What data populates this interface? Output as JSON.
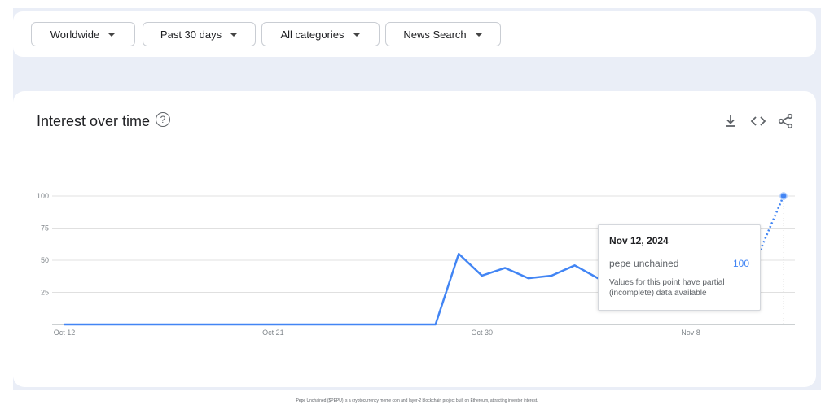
{
  "filters": [
    {
      "label": "Worldwide"
    },
    {
      "label": "Past 30 days"
    },
    {
      "label": "All categories"
    },
    {
      "label": "News Search"
    }
  ],
  "card": {
    "title": "Interest over time",
    "help_icon": "question-circle-icon",
    "actions": [
      "download-icon",
      "embed-code-icon",
      "share-icon"
    ]
  },
  "tooltip": {
    "date": "Nov 12, 2024",
    "term": "pepe unchained",
    "value": "100",
    "note": "Values for this point have partial (incomplete) data available"
  },
  "footnote": "Pepe Unchained ($PEPU) is a cryptocurrency meme coin and layer-2 blockchain project built on Ethereum, attracting investor interest.",
  "colors": {
    "line": "#4285f4",
    "grid": "#e0e0e0",
    "card_bg": "#ffffff",
    "page_bg": "#eaeef7"
  },
  "chart_data": {
    "type": "line",
    "title": "",
    "xlabel": "",
    "ylabel": "",
    "ylim": [
      0,
      100
    ],
    "yticks": [
      "100",
      "75",
      "50",
      "25"
    ],
    "xticks": [
      "Oct 12",
      "Oct 21",
      "Oct 30",
      "Nov 8"
    ],
    "series": [
      {
        "name": "pepe unchained",
        "partial_from": "Nov 11",
        "points": [
          {
            "x": "Oct 12",
            "y": 0
          },
          {
            "x": "Oct 13",
            "y": 0
          },
          {
            "x": "Oct 14",
            "y": 0
          },
          {
            "x": "Oct 15",
            "y": 0
          },
          {
            "x": "Oct 16",
            "y": 0
          },
          {
            "x": "Oct 17",
            "y": 0
          },
          {
            "x": "Oct 18",
            "y": 0
          },
          {
            "x": "Oct 19",
            "y": 0
          },
          {
            "x": "Oct 20",
            "y": 0
          },
          {
            "x": "Oct 21",
            "y": 0
          },
          {
            "x": "Oct 22",
            "y": 0
          },
          {
            "x": "Oct 23",
            "y": 0
          },
          {
            "x": "Oct 24",
            "y": 0
          },
          {
            "x": "Oct 25",
            "y": 0
          },
          {
            "x": "Oct 26",
            "y": 0
          },
          {
            "x": "Oct 27",
            "y": 0
          },
          {
            "x": "Oct 28",
            "y": 0
          },
          {
            "x": "Oct 29",
            "y": 55
          },
          {
            "x": "Oct 30",
            "y": 38
          },
          {
            "x": "Oct 31",
            "y": 44
          },
          {
            "x": "Nov 1",
            "y": 36
          },
          {
            "x": "Nov 2",
            "y": 38
          },
          {
            "x": "Nov 3",
            "y": 46
          },
          {
            "x": "Nov 4",
            "y": 36
          },
          {
            "x": "Nov 5",
            "y": 60
          },
          {
            "x": "Nov 6",
            "y": 53
          },
          {
            "x": "Nov 7",
            "y": 58
          },
          {
            "x": "Nov 8",
            "y": 46
          },
          {
            "x": "Nov 9",
            "y": 56
          },
          {
            "x": "Nov 10",
            "y": 57
          },
          {
            "x": "Nov 11",
            "y": 58
          },
          {
            "x": "Nov 12",
            "y": 100
          }
        ]
      }
    ]
  }
}
